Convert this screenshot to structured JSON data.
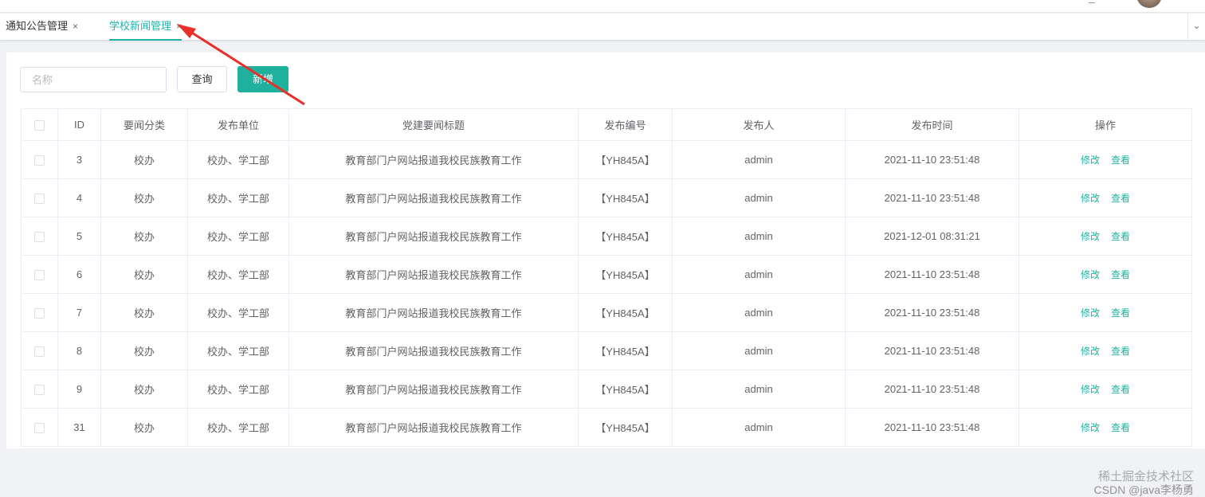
{
  "tabs": [
    {
      "label": "通知公告管理",
      "close": "×",
      "active": false
    },
    {
      "label": "学校新闻管理",
      "close": "×",
      "active": true
    }
  ],
  "tab_more_icon": "chevron-down-icon",
  "search": {
    "placeholder": "名称",
    "value": ""
  },
  "buttons": {
    "query": "查询",
    "add": "新增"
  },
  "table": {
    "columns": [
      "ID",
      "要闻分类",
      "发布单位",
      "党建要闻标题",
      "发布编号",
      "发布人",
      "发布时间",
      "操作"
    ],
    "rows": [
      {
        "id": "3",
        "category": "校办",
        "unit": "校办、学工部",
        "title": "教育部门户网站报道我校民族教育工作",
        "code": "【YH845A】",
        "publisher": "admin",
        "time": "2021-11-10 23:51:48"
      },
      {
        "id": "4",
        "category": "校办",
        "unit": "校办、学工部",
        "title": "教育部门户网站报道我校民族教育工作",
        "code": "【YH845A】",
        "publisher": "admin",
        "time": "2021-11-10 23:51:48"
      },
      {
        "id": "5",
        "category": "校办",
        "unit": "校办、学工部",
        "title": "教育部门户网站报道我校民族教育工作",
        "code": "【YH845A】",
        "publisher": "admin",
        "time": "2021-12-01 08:31:21"
      },
      {
        "id": "6",
        "category": "校办",
        "unit": "校办、学工部",
        "title": "教育部门户网站报道我校民族教育工作",
        "code": "【YH845A】",
        "publisher": "admin",
        "time": "2021-11-10 23:51:48"
      },
      {
        "id": "7",
        "category": "校办",
        "unit": "校办、学工部",
        "title": "教育部门户网站报道我校民族教育工作",
        "code": "【YH845A】",
        "publisher": "admin",
        "time": "2021-11-10 23:51:48"
      },
      {
        "id": "8",
        "category": "校办",
        "unit": "校办、学工部",
        "title": "教育部门户网站报道我校民族教育工作",
        "code": "【YH845A】",
        "publisher": "admin",
        "time": "2021-11-10 23:51:48"
      },
      {
        "id": "9",
        "category": "校办",
        "unit": "校办、学工部",
        "title": "教育部门户网站报道我校民族教育工作",
        "code": "【YH845A】",
        "publisher": "admin",
        "time": "2021-11-10 23:51:48"
      },
      {
        "id": "31",
        "category": "校办",
        "unit": "校办、学工部",
        "title": "教育部门户网站报道我校民族教育工作",
        "code": "【YH845A】",
        "publisher": "admin",
        "time": "2021-11-10 23:51:48"
      }
    ],
    "actions": {
      "edit": "修改",
      "view": "查看"
    }
  },
  "watermark": {
    "line1": "稀土掘金技术社区",
    "line2": "CSDN @java李杨勇"
  },
  "colors": {
    "accent": "#1fb19e",
    "arrow": "#e8302a"
  }
}
